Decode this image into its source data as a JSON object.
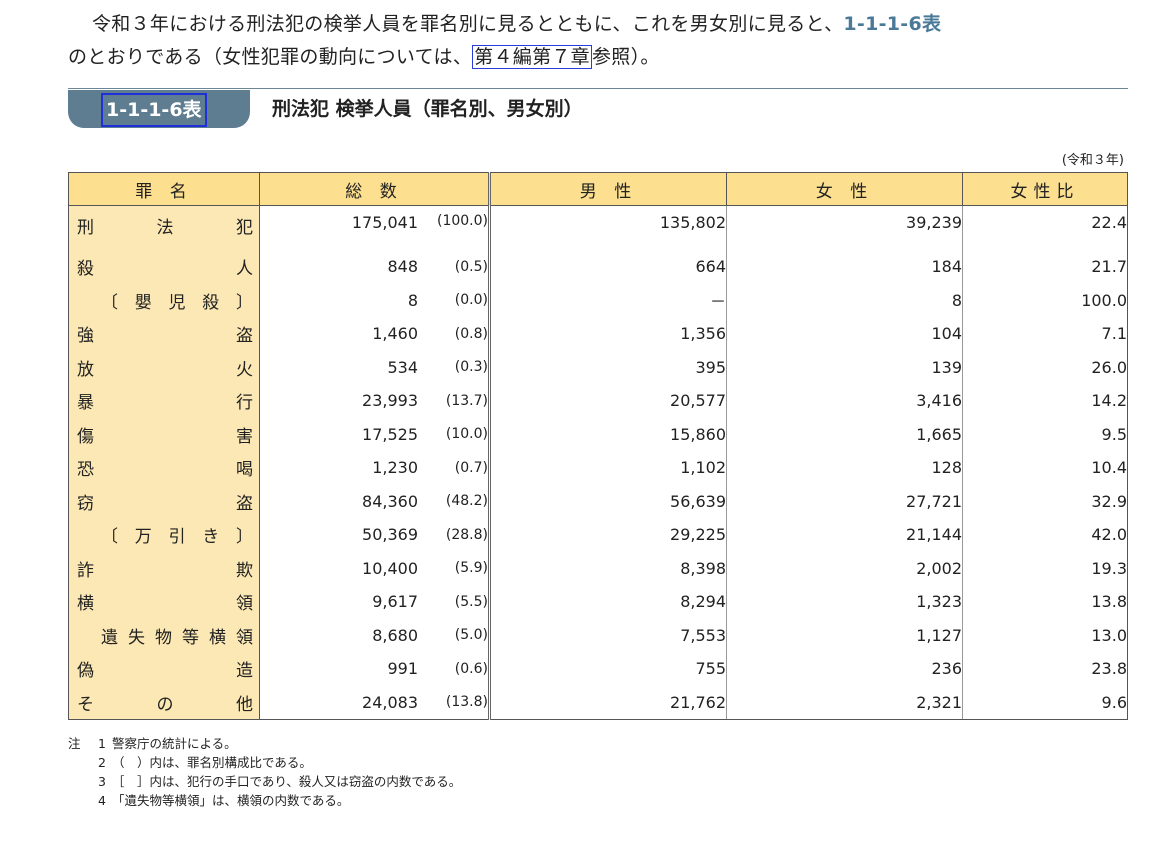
{
  "intro": {
    "line1_before": "令和３年における刑法犯の検挙人員を罪名別に見るとともに、これを男女別に見ると、",
    "table_ref": "1-1-1-6表",
    "line2_before": "のとおりである（女性犯罪の動向については、",
    "link_text": "第４編第７章",
    "line2_after": "参照）。"
  },
  "table": {
    "label": "1-1-1-6表",
    "title": "刑法犯 検挙人員（罪名別、男女別）",
    "year_note": "(令和３年)",
    "headers": {
      "name": "罪 名",
      "total": "総 数",
      "male": "男 性",
      "female": "女 性",
      "ratio": "女性比"
    },
    "rows": [
      {
        "name": [
          "刑",
          "法",
          "犯"
        ],
        "total": "175,041",
        "pct": "(100.0)",
        "male": "135,802",
        "female": "39,239",
        "ratio": "22.4"
      },
      {
        "name": [
          "殺",
          "人"
        ],
        "total": "848",
        "pct": "(0.5)",
        "male": "664",
        "female": "184",
        "ratio": "21.7"
      },
      {
        "name": [
          "〔",
          "嬰",
          "児",
          "殺",
          "〕"
        ],
        "total": "8",
        "pct": "(0.0)",
        "male": "－",
        "female": "8",
        "ratio": "100.0"
      },
      {
        "name": [
          "強",
          "盗"
        ],
        "total": "1,460",
        "pct": "(0.8)",
        "male": "1,356",
        "female": "104",
        "ratio": "7.1"
      },
      {
        "name": [
          "放",
          "火"
        ],
        "total": "534",
        "pct": "(0.3)",
        "male": "395",
        "female": "139",
        "ratio": "26.0"
      },
      {
        "name": [
          "暴",
          "行"
        ],
        "total": "23,993",
        "pct": "(13.7)",
        "male": "20,577",
        "female": "3,416",
        "ratio": "14.2"
      },
      {
        "name": [
          "傷",
          "害"
        ],
        "total": "17,525",
        "pct": "(10.0)",
        "male": "15,860",
        "female": "1,665",
        "ratio": "9.5"
      },
      {
        "name": [
          "恐",
          "喝"
        ],
        "total": "1,230",
        "pct": "(0.7)",
        "male": "1,102",
        "female": "128",
        "ratio": "10.4"
      },
      {
        "name": [
          "窃",
          "盗"
        ],
        "total": "84,360",
        "pct": "(48.2)",
        "male": "56,639",
        "female": "27,721",
        "ratio": "32.9"
      },
      {
        "name": [
          "〔",
          "万",
          "引",
          "き",
          "〕"
        ],
        "total": "50,369",
        "pct": "(28.8)",
        "male": "29,225",
        "female": "21,144",
        "ratio": "42.0"
      },
      {
        "name": [
          "詐",
          "欺"
        ],
        "total": "10,400",
        "pct": "(5.9)",
        "male": "8,398",
        "female": "2,002",
        "ratio": "19.3"
      },
      {
        "name": [
          "横",
          "領"
        ],
        "total": "9,617",
        "pct": "(5.5)",
        "male": "8,294",
        "female": "1,323",
        "ratio": "13.8"
      },
      {
        "name": [
          "遺",
          "失",
          "物",
          "等",
          "横",
          "領"
        ],
        "total": "8,680",
        "pct": "(5.0)",
        "male": "7,553",
        "female": "1,127",
        "ratio": "13.0"
      },
      {
        "name": [
          "偽",
          "造"
        ],
        "total": "991",
        "pct": "(0.6)",
        "male": "755",
        "female": "236",
        "ratio": "23.8"
      },
      {
        "name": [
          "そ",
          "の",
          "他"
        ],
        "total": "24,083",
        "pct": "(13.8)",
        "male": "21,762",
        "female": "2,321",
        "ratio": "9.6"
      }
    ]
  },
  "notes": {
    "label": "注",
    "items": [
      {
        "num": "1",
        "text": "警察庁の統計による。"
      },
      {
        "num": "2",
        "text": "（　）内は、罪名別構成比である。"
      },
      {
        "num": "3",
        "text": "［　］内は、犯行の手口であり、殺人又は窃盗の内数である。"
      },
      {
        "num": "4",
        "text": "「遺失物等横領」は、横領の内数である。"
      }
    ]
  }
}
